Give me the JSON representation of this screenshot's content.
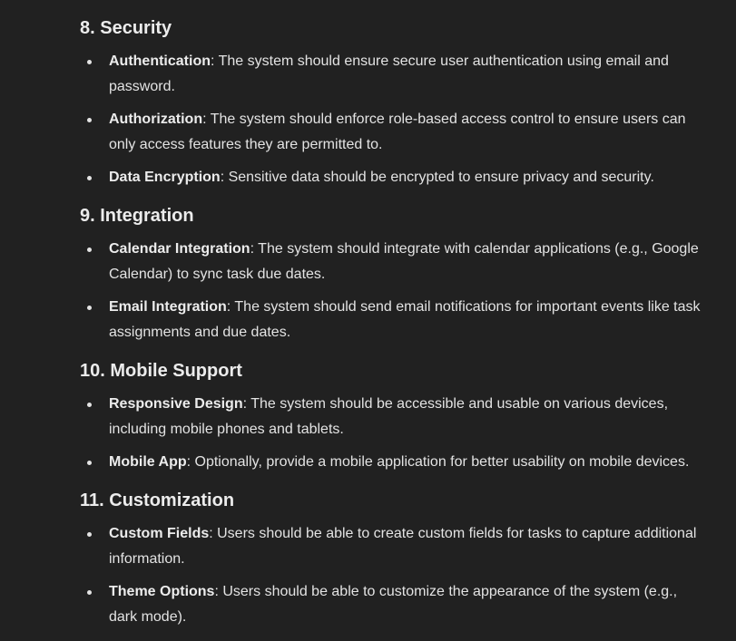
{
  "sections": [
    {
      "heading": "8. Security",
      "items": [
        {
          "term": "Authentication",
          "text": ": The system should ensure secure user authentication using email and password."
        },
        {
          "term": "Authorization",
          "text": ": The system should enforce role-based access control to ensure users can only access features they are permitted to."
        },
        {
          "term": "Data Encryption",
          "text": ": Sensitive data should be encrypted to ensure privacy and security."
        }
      ]
    },
    {
      "heading": "9. Integration",
      "items": [
        {
          "term": "Calendar Integration",
          "text": ": The system should integrate with calendar applications (e.g., Google Calendar) to sync task due dates."
        },
        {
          "term": "Email Integration",
          "text": ": The system should send email notifications for important events like task assignments and due dates."
        }
      ]
    },
    {
      "heading": "10. Mobile Support",
      "items": [
        {
          "term": "Responsive Design",
          "text": ": The system should be accessible and usable on various devices, including mobile phones and tablets."
        },
        {
          "term": "Mobile App",
          "text": ": Optionally, provide a mobile application for better usability on mobile devices."
        }
      ]
    },
    {
      "heading": "11. Customization",
      "items": [
        {
          "term": "Custom Fields",
          "text": ": Users should be able to create custom fields for tasks to capture additional information."
        },
        {
          "term": "Theme Options",
          "text": ": Users should be able to customize the appearance of the system (e.g., dark mode)."
        }
      ]
    }
  ]
}
